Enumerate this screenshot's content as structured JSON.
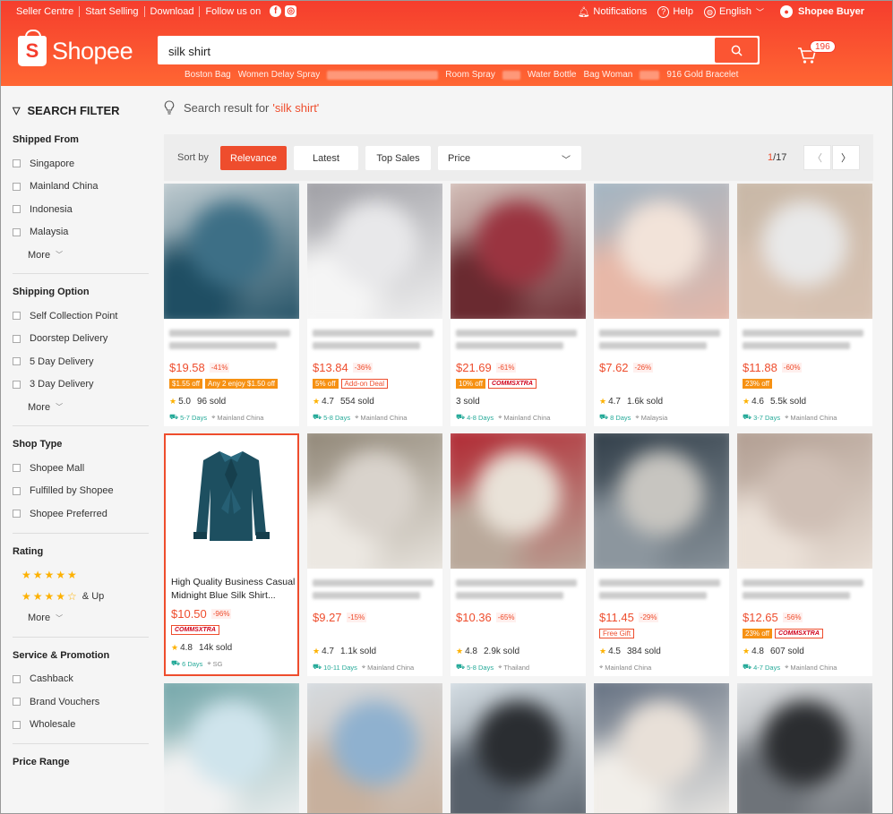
{
  "topbar": {
    "links": [
      "Seller Centre",
      "Start Selling",
      "Download",
      "Follow us on"
    ],
    "social_icons": [
      "facebook-icon",
      "instagram-icon"
    ],
    "notifications": "Notifications",
    "help": "Help",
    "language": "English",
    "user": "Shopee Buyer"
  },
  "header": {
    "logo_text": "Shopee",
    "search_value": "silk shirt",
    "cart_count": "196",
    "suggestions": [
      "Boston Bag",
      "Women Delay Spray",
      "Room Spray",
      "Water Bottle",
      "Bag Woman",
      "916 Gold Bracelet"
    ]
  },
  "sidebar": {
    "title": "SEARCH FILTER",
    "groups": [
      {
        "title": "Shipped From",
        "options": [
          "Singapore",
          "Mainland China",
          "Indonesia",
          "Malaysia"
        ],
        "more": "More"
      },
      {
        "title": "Shipping Option",
        "options": [
          "Self Collection Point",
          "Doorstep Delivery",
          "5 Day Delivery",
          "3 Day Delivery"
        ],
        "more": "More"
      },
      {
        "title": "Shop Type",
        "options": [
          "Shopee Mall",
          "Fulfilled by Shopee",
          "Shopee Preferred"
        ]
      },
      {
        "title": "Rating",
        "and_up": "& Up",
        "more": "More"
      },
      {
        "title": "Service & Promotion",
        "options": [
          "Cashback",
          "Brand Vouchers",
          "Wholesale"
        ]
      },
      {
        "title": "Price Range"
      }
    ]
  },
  "main": {
    "result_prefix": "Search result for ",
    "result_keyword": "'silk shirt'",
    "sort": {
      "label": "Sort by",
      "buttons": [
        "Relevance",
        "Latest",
        "Top Sales"
      ],
      "price": "Price",
      "page_current": "1",
      "page_total": "/17"
    }
  },
  "products": [
    {
      "price": "$19.58",
      "disc": "-41%",
      "tags": [
        "$1.55 off",
        "Any 2 enjoy $1.50 off"
      ],
      "rating": "5.0",
      "sold": "96 sold",
      "days": "5-7 Days",
      "loc": "Mainland China"
    },
    {
      "price": "$13.84",
      "disc": "-36%",
      "tags": [
        "5% off",
        "Add-on Deal"
      ],
      "rating": "4.7",
      "sold": "554 sold",
      "days": "5-8 Days",
      "loc": "Mainland China"
    },
    {
      "price": "$21.69",
      "disc": "-61%",
      "tags": [
        "10% off",
        "COMMSXTRA"
      ],
      "rating": "",
      "sold": "3 sold",
      "days": "4-8 Days",
      "loc": "Mainland China"
    },
    {
      "price": "$7.62",
      "disc": "-26%",
      "tags": [],
      "rating": "4.7",
      "sold": "1.6k sold",
      "days": "8 Days",
      "loc": "Malaysia"
    },
    {
      "price": "$11.88",
      "disc": "-60%",
      "tags": [
        "23% off"
      ],
      "rating": "4.6",
      "sold": "5.5k sold",
      "days": "3-7 Days",
      "loc": "Mainland China"
    },
    {
      "title": "High Quality Business Casual Midnight Blue Silk Shirt...",
      "price": "$10.50",
      "disc": "-96%",
      "tags": [
        "COMMSXTRA"
      ],
      "rating": "4.8",
      "sold": "14k sold",
      "days": "6 Days",
      "loc": "SG"
    },
    {
      "price": "$9.27",
      "disc": "-15%",
      "tags": [],
      "rating": "4.7",
      "sold": "1.1k sold",
      "days": "10-11 Days",
      "loc": "Mainland China"
    },
    {
      "price": "$10.36",
      "disc": "-65%",
      "tags": [],
      "rating": "4.8",
      "sold": "2.9k sold",
      "days": "5-8 Days",
      "loc": "Thailand"
    },
    {
      "price": "$11.45",
      "disc": "-29%",
      "tags": [
        "Free Gift"
      ],
      "rating": "4.5",
      "sold": "384 sold",
      "days": "",
      "loc": "Mainland China"
    },
    {
      "price": "$12.65",
      "disc": "-56%",
      "tags": [
        "23% off",
        "COMMSXTRA"
      ],
      "rating": "4.8",
      "sold": "607 sold",
      "days": "4-7 Days",
      "loc": "Mainland China"
    }
  ],
  "colors": {
    "brand": "#ee4d2d",
    "star": "#fdb100",
    "ship": "#26aa99"
  }
}
